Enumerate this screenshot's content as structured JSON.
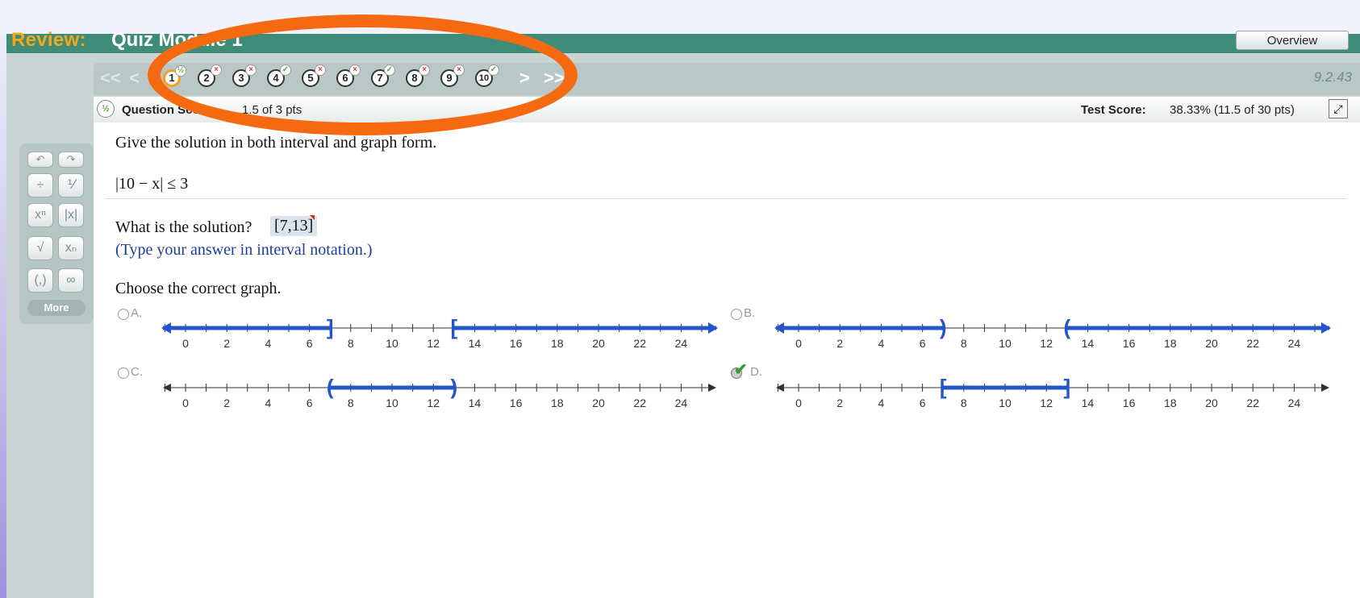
{
  "header": {
    "review_label": "Review:",
    "title": "Quiz Module 1",
    "overview_button": "Overview"
  },
  "nav": {
    "first": "<<",
    "prev": "<",
    "next": ">",
    "last": ">>",
    "questions": [
      {
        "num": "1",
        "status": "partial",
        "current": true
      },
      {
        "num": "2",
        "status": "incorrect"
      },
      {
        "num": "3",
        "status": "incorrect"
      },
      {
        "num": "4",
        "status": "correct"
      },
      {
        "num": "5",
        "status": "incorrect"
      },
      {
        "num": "6",
        "status": "incorrect"
      },
      {
        "num": "7",
        "status": "correct"
      },
      {
        "num": "8",
        "status": "incorrect"
      },
      {
        "num": "9",
        "status": "incorrect"
      },
      {
        "num": "10",
        "status": "correct"
      }
    ],
    "version": "9.2.43"
  },
  "score": {
    "question_label": "Question Score:",
    "question_value": "1.5 of 3 pts",
    "test_label": "Test Score:",
    "test_value": "38.33% (11.5 of 30 pts)"
  },
  "question": {
    "prompt": "Give the solution in both interval and graph form.",
    "inequality": "|10 − x| ≤ 3",
    "solution_prompt": "What is the solution?",
    "answer": "[7,13]",
    "hint": "(Type your answer in interval notation.)",
    "graph_prompt": "Choose the correct graph."
  },
  "options": [
    {
      "label": "A.",
      "selected": false,
      "intervals": [
        [
          -2,
          7
        ],
        [
          13,
          26
        ]
      ],
      "brackets": [
        "]",
        "["
      ]
    },
    {
      "label": "B.",
      "selected": false,
      "intervals": [
        [
          -2,
          7
        ],
        [
          13,
          26
        ]
      ],
      "brackets": [
        ")",
        "("
      ]
    },
    {
      "label": "C.",
      "selected": false,
      "intervals": [
        [
          7,
          13
        ]
      ],
      "brackets": [
        "(",
        ")"
      ]
    },
    {
      "label": "D.",
      "selected": true,
      "intervals": [
        [
          7,
          13
        ]
      ],
      "brackets": [
        "[",
        "]"
      ]
    }
  ],
  "axis_ticks": [
    "0",
    "2",
    "4",
    "6",
    "8",
    "10",
    "12",
    "14",
    "16",
    "18",
    "20",
    "22",
    "24"
  ],
  "colors": {
    "header_green": "#3f8c78",
    "review_orange": "#f2a81a",
    "interval_blue": "#2356c9",
    "annotation_orange": "#f56a10"
  },
  "toolbar": {
    "more_label": "More"
  }
}
